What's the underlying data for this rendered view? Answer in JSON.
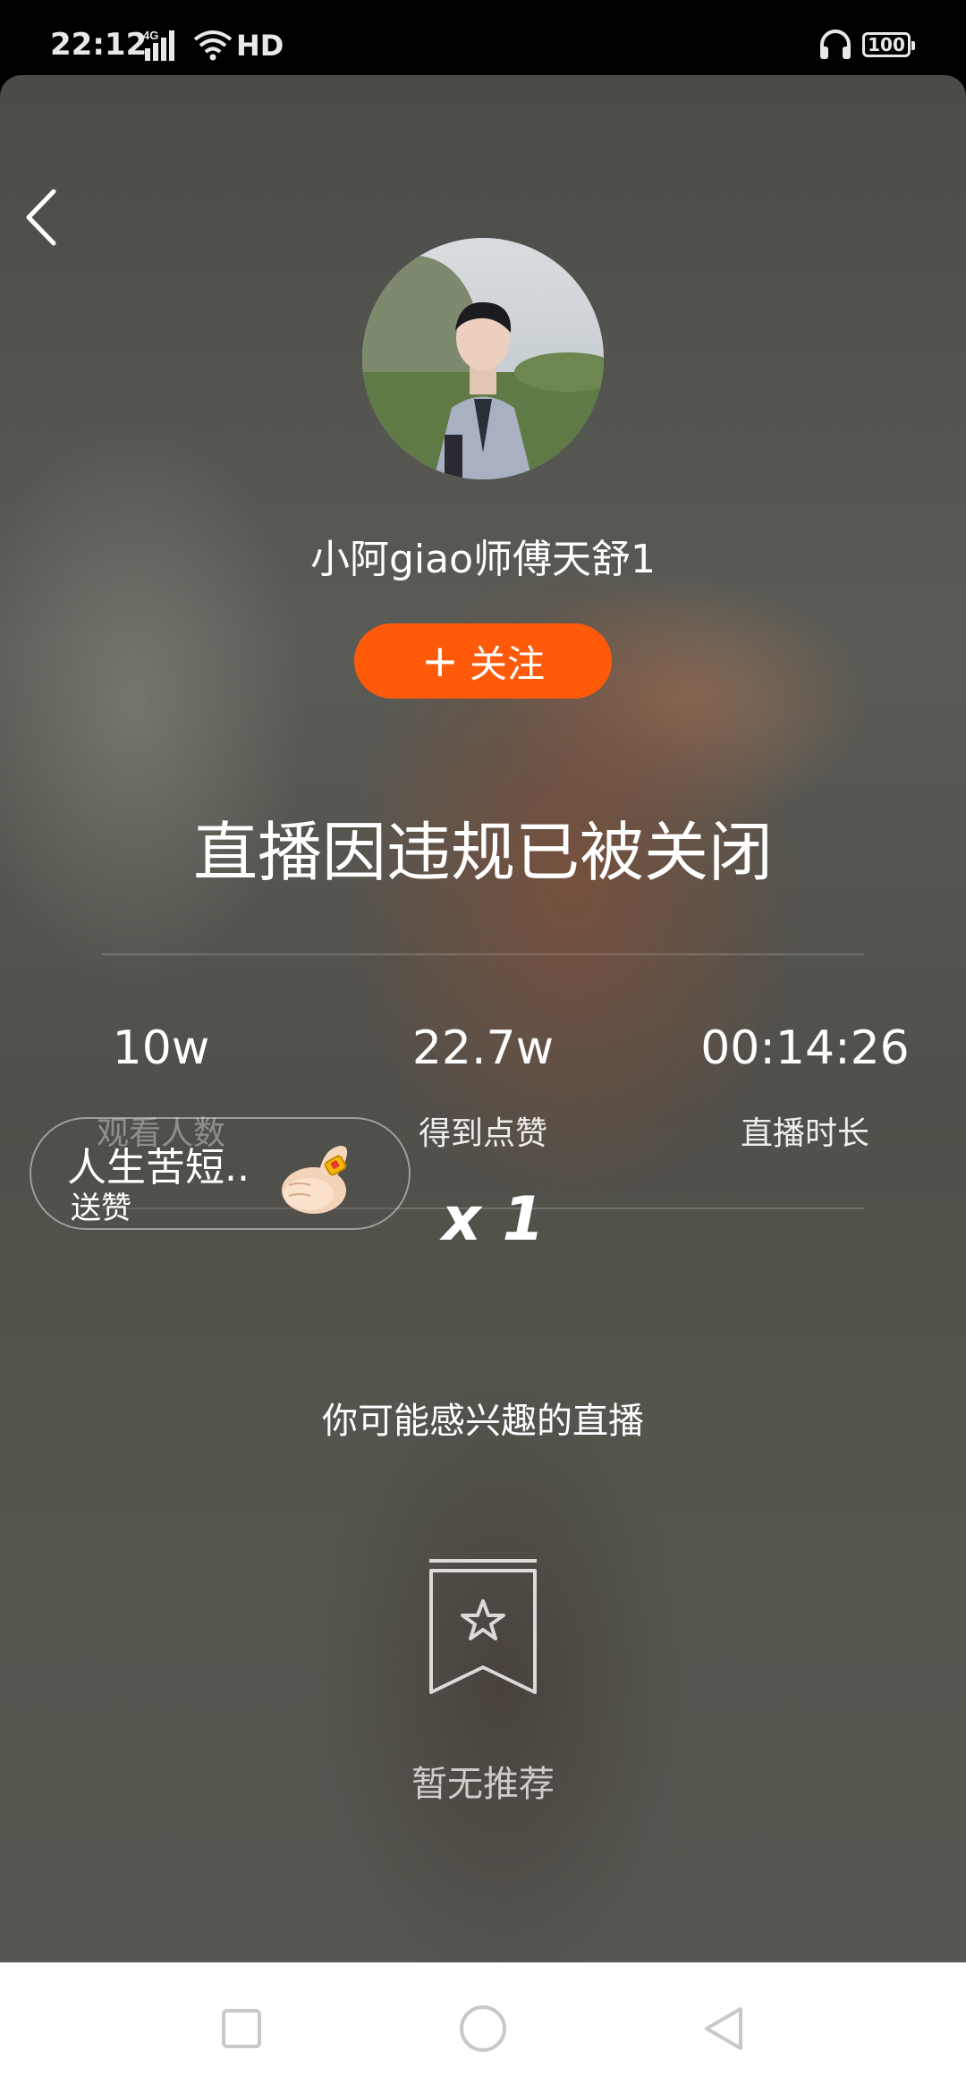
{
  "status_bar": {
    "time": "22:12",
    "network": "4G",
    "hd": "HD",
    "battery": "100"
  },
  "streamer": {
    "name": "小阿giao师傅天舒1",
    "follow_label": "关注",
    "follow_color": "#ff5a0a"
  },
  "live": {
    "closed_message": "直播因违规已被关闭"
  },
  "stats": [
    {
      "value": "10w",
      "label": "观看人数"
    },
    {
      "value": "22.7w",
      "label": "得到点赞"
    },
    {
      "value": "00:14:26",
      "label": "直播时长"
    }
  ],
  "gift_notice": {
    "user": "人生苦短..",
    "action": "送赞",
    "count": "x 1",
    "icon": "thumbs-up-icon"
  },
  "recommendations": {
    "heading": "你可能感兴趣的直播",
    "empty_text": "暂无推荐",
    "empty_icon": "bookmark-star-icon"
  }
}
